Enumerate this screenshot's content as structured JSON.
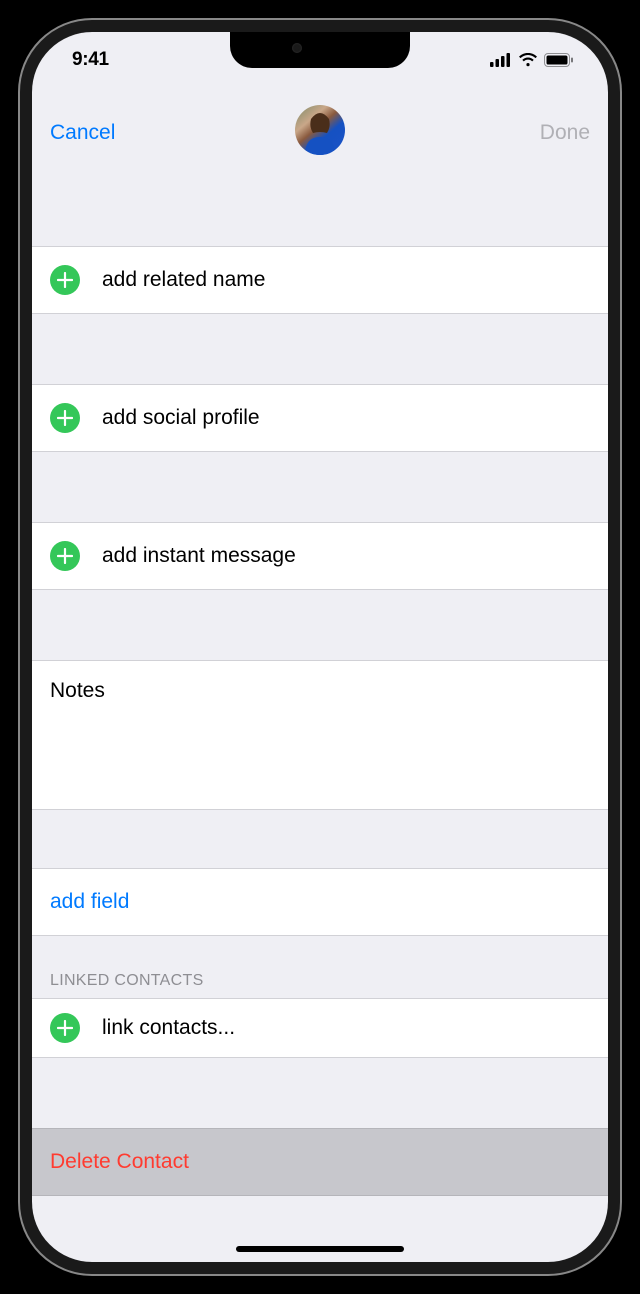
{
  "status": {
    "time": "9:41"
  },
  "nav": {
    "cancel": "Cancel",
    "done": "Done"
  },
  "rows": {
    "related_name": "add related name",
    "social_profile": "add social profile",
    "instant_message": "add instant message",
    "notes_label": "Notes",
    "add_field": "add field",
    "linked_header": "LINKED CONTACTS",
    "link_contacts": "link contacts...",
    "delete": "Delete Contact"
  }
}
